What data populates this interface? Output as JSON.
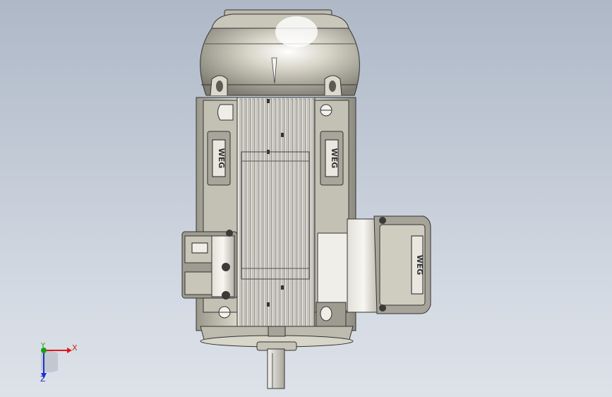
{
  "viewport": {
    "background_top": "#aeb8c7",
    "background_bottom": "#dde2e9"
  },
  "model": {
    "name": "electric-motor",
    "body_color": "#d6d3c6",
    "shadow_color": "#8a877c",
    "logo_text": "WEG"
  },
  "triad": {
    "x_label": "X",
    "y_label": "Y",
    "z_label": "Z",
    "x_color": "#e01818",
    "y_color": "#18a018",
    "z_color": "#2030d0"
  }
}
